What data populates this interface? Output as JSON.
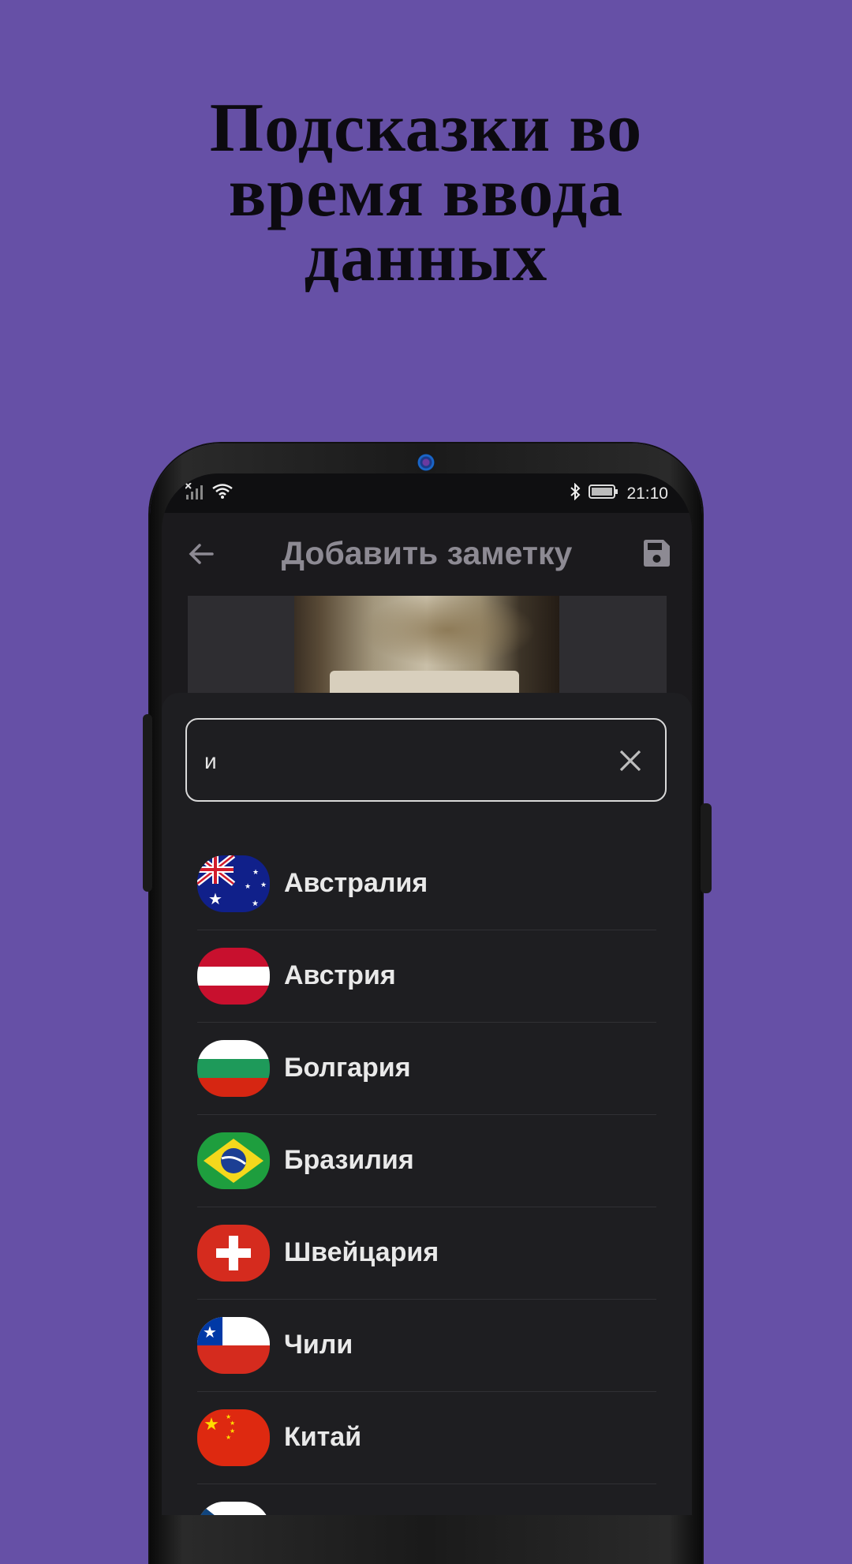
{
  "headline": {
    "line1": "Подсказки во",
    "line2": "время ввода",
    "line3": "данных"
  },
  "statusbar": {
    "time": "21:10"
  },
  "appbar": {
    "title": "Добавить заметку"
  },
  "search": {
    "value": "и"
  },
  "countries": [
    {
      "name": "Австралия",
      "flag": "australia-flag-icon"
    },
    {
      "name": "Австрия",
      "flag": "austria-flag-icon"
    },
    {
      "name": "Болгария",
      "flag": "bulgaria-flag-icon"
    },
    {
      "name": "Бразилия",
      "flag": "brazil-flag-icon"
    },
    {
      "name": "Швейцария",
      "flag": "switzerland-flag-icon"
    },
    {
      "name": "Чили",
      "flag": "chile-flag-icon"
    },
    {
      "name": "Китай",
      "flag": "china-flag-icon"
    },
    {
      "name": "",
      "flag": "czech-flag-icon"
    }
  ],
  "colors": {
    "background": "#6650a6",
    "sheet": "#1e1e21",
    "title": "#8d8a93"
  }
}
